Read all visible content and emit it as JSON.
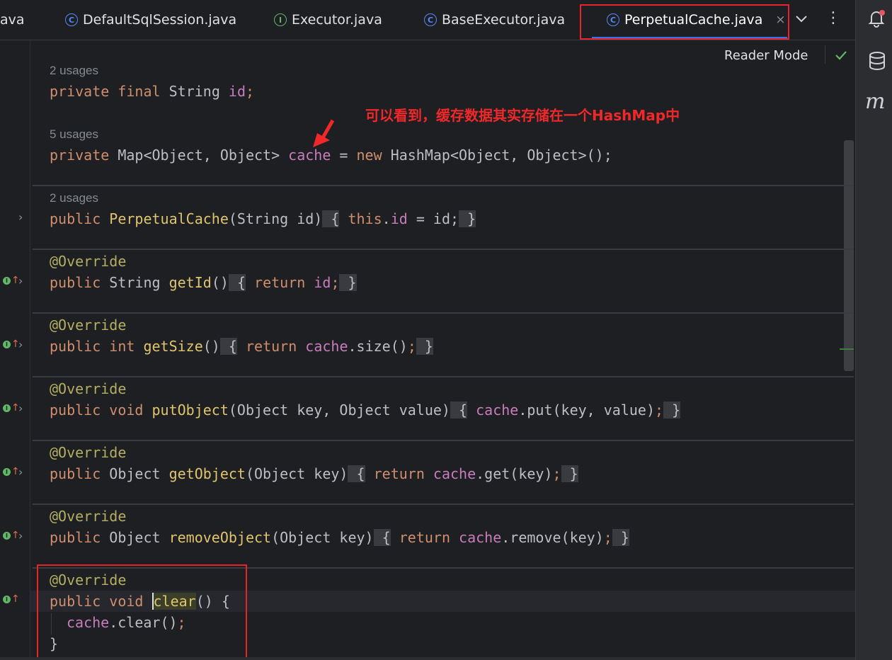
{
  "tabs": [
    {
      "label": "ava",
      "icon": "none"
    },
    {
      "label": "DefaultSqlSession.java",
      "icon": "class-icon"
    },
    {
      "label": "Executor.java",
      "icon": "interface-icon"
    },
    {
      "label": "BaseExecutor.java",
      "icon": "class-icon"
    },
    {
      "label": "PerpetualCache.java",
      "icon": "class-icon",
      "active": true,
      "close": "×"
    }
  ],
  "toolbar": {
    "more": "⋮",
    "reader_mode": "Reader Mode"
  },
  "annotation": {
    "text": "可以看到，缓存数据其实存储在一个HashMap中"
  },
  "icon_letters": {
    "class": "C",
    "interface": "I",
    "maven": "m",
    "impl_bulb": "I",
    "up_arrow": "↑",
    "chevron": "›"
  },
  "code": {
    "usages_id": "2 usages",
    "usages_cache": "5 usages",
    "usages_ctor": "2 usages",
    "line_id": {
      "kw1": "private",
      "kw2": "final",
      "type": "String",
      "name": "id",
      "end": ";"
    },
    "line_cache": {
      "kw1": "private",
      "type": "Map<Object, Object>",
      "name": "cache",
      "eq": " = ",
      "kw_new": "new",
      "rest": "HashMap<Object, Object>();"
    },
    "ctor": {
      "kw": "public",
      "name": "PerpetualCache",
      "params": "(String id)",
      "open": " {",
      "kw_this": "this",
      "dot": ".",
      "fld": "id",
      "rest": " = id;",
      "close": " }"
    },
    "override": "@Override",
    "getId": {
      "sig_kw": "public",
      "ret": "String",
      "name": "getId",
      "params": "()",
      "open": " {",
      "kw_ret": "return",
      "body": "id",
      "semi": ";",
      "close": " }"
    },
    "getSize": {
      "sig_kw": "public",
      "ret": "int",
      "name": "getSize",
      "params": "()",
      "open": " {",
      "kw_ret": "return",
      "fld": "cache",
      "body": ".size()",
      "semi": ";",
      "close": " }"
    },
    "putObject": {
      "sig_kw": "public",
      "ret": "void",
      "name": "putObject",
      "params": "(Object key, Object value)",
      "open": " {",
      "fld": "cache",
      "body": ".put(key, value)",
      "semi": ";",
      "close": " }"
    },
    "getObject": {
      "sig_kw": "public",
      "ret": "Object",
      "name": "getObject",
      "params": "(Object key)",
      "open": " {",
      "kw_ret": "return",
      "fld": "cache",
      "body": ".get(key)",
      "semi": ";",
      "close": " }"
    },
    "removeObject": {
      "sig_kw": "public",
      "ret": "Object",
      "name": "removeObject",
      "params": "(Object key)",
      "open": " {",
      "kw_ret": "return",
      "fld": "cache",
      "body": ".remove(key)",
      "semi": ";",
      "close": " }"
    },
    "clear": {
      "sig_kw": "public",
      "ret": "void",
      "name": "clear",
      "params": "() {",
      "fld": "cache",
      "body": ".clear()",
      "semi": ";",
      "close": "}"
    }
  },
  "colors": {
    "accent": "#3574f0",
    "annotation_red": "#e8232c",
    "keyword": "#cf8e6d",
    "field": "#c77dbb",
    "method": "#e0c46c"
  }
}
